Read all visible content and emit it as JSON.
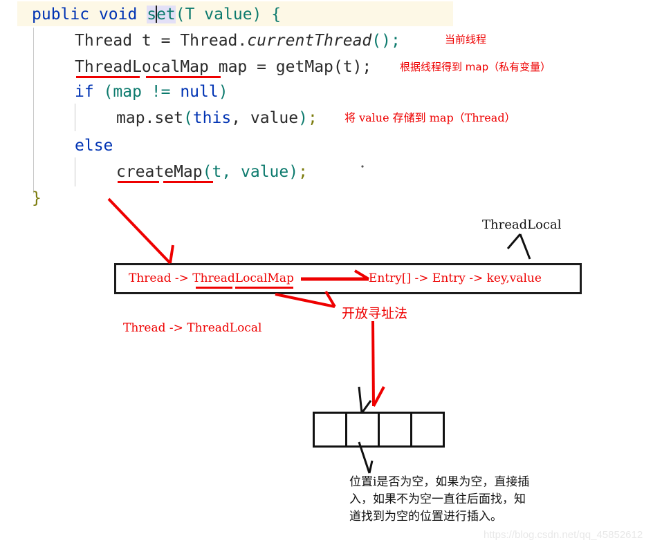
{
  "editor": {
    "code_lines": [
      {
        "indent": 0,
        "text": "public void set(T value) {"
      },
      {
        "indent": 1,
        "text": "Thread t = Thread.currentThread();"
      },
      {
        "indent": 1,
        "text": "ThreadLocalMap map = getMap(t);"
      },
      {
        "indent": 1,
        "text": "if (map != null)"
      },
      {
        "indent": 2,
        "text": "map.set(this, value);"
      },
      {
        "indent": 1,
        "text": "else"
      },
      {
        "indent": 2,
        "text": "createMap(t, value);"
      },
      {
        "indent": 0,
        "text": "}"
      }
    ],
    "tokens": {
      "public": "public",
      "void": "void",
      "set": "set",
      "t_param": "(T value) {",
      "thread_decl": "Thread t = Thread.",
      "current_thread": "currentThread",
      "call_end": "();",
      "tlm_type": "ThreadLocalMap",
      "map_assign": " map = getMap(t);",
      "if_kw": "if",
      "if_cond_open": " (map != ",
      "null_kw": "null",
      "paren_close": ")",
      "map_set": "map.set",
      "paren_open": "(",
      "this_kw": "this",
      "comma_value": ", value",
      "semicolon": ";",
      "else_kw": "else",
      "create_map": "createMap",
      "create_args": "(t, value",
      "close_brace": "}"
    },
    "caret_after": "s",
    "selection_text": "set",
    "highlight_color": "#fdf8e6",
    "selection_color": "#e3e0f7",
    "keyword_color": "#0033b3",
    "paren_color": "#0c7a6d",
    "semicolon_color": "#7a7a0a",
    "text_color": "#2b2b2b",
    "annotation_color": "#ee0000"
  },
  "annotations": {
    "current_thread_note": "当前线程",
    "get_map_note": "根据线程得到 map（私有变量）",
    "store_value_note": "将 value 存储到 map（Thread）",
    "open_addressing_note": "开放寻址法"
  },
  "diagram": {
    "box": {
      "segment_thread": "Thread -> ",
      "segment_tlm": "ThreadLocalMap",
      "segment_tail": "Entry[] -> Entry -> key,value",
      "color": "#ee0000",
      "border_color": "#1c1c1c"
    },
    "threadlocal_label": "ThreadLocal",
    "thread_threadlocal_label": "Thread -> ThreadLocal",
    "array_cell_count": 4
  },
  "bottom_note": "位置i是否为空，如果为空，直接插入，如果不为空一直往后面找，知道找到为空的位置进行插入。",
  "watermark": "https://blog.csdn.net/qq_45852612"
}
